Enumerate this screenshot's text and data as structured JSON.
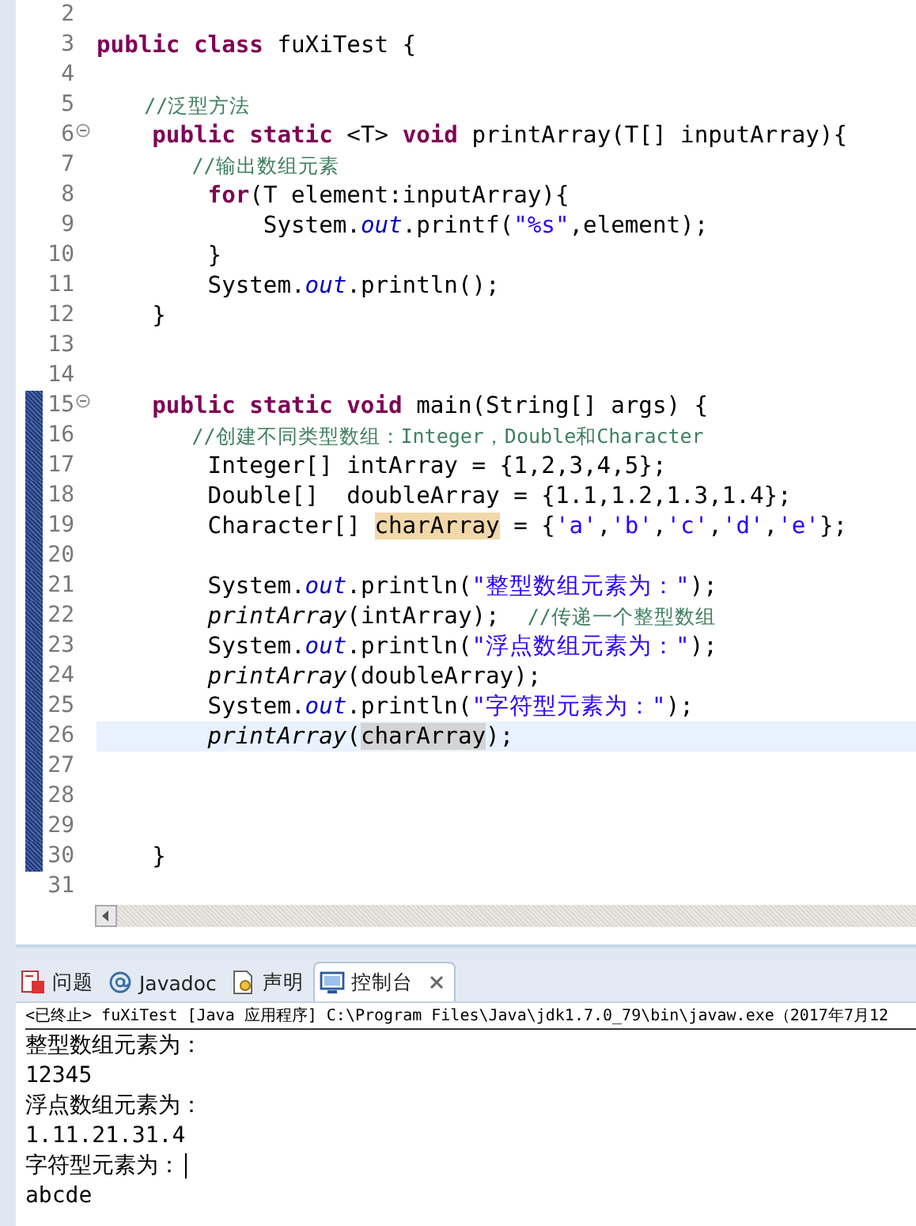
{
  "editor": {
    "lines": [
      {
        "number": "2",
        "changed": false,
        "fold": false,
        "current": false
      },
      {
        "number": "3",
        "changed": false,
        "fold": false,
        "current": false,
        "tokens": [
          {
            "t": "public class",
            "kind": "kw"
          },
          {
            "t": " fuXiTest {",
            "kind": "plain"
          }
        ]
      },
      {
        "number": "4",
        "changed": false,
        "fold": false,
        "current": false
      },
      {
        "number": "5",
        "changed": false,
        "fold": false,
        "current": false,
        "tokens": [
          {
            "t": "    //泛型方法",
            "kind": "comment"
          }
        ]
      },
      {
        "number": "6",
        "changed": false,
        "fold": true,
        "current": false,
        "tokens": [
          {
            "t": "    public static",
            "kind": "kw"
          },
          {
            "t": " <T> ",
            "kind": "plain"
          },
          {
            "t": "void",
            "kind": "kw"
          },
          {
            "t": " printArray(T[] inputArray){",
            "kind": "plain"
          }
        ]
      },
      {
        "number": "7",
        "changed": false,
        "fold": false,
        "current": false,
        "tokens": [
          {
            "t": "        //输出数组元素",
            "kind": "comment"
          }
        ]
      },
      {
        "number": "8",
        "changed": false,
        "fold": false,
        "current": false,
        "tokens": [
          {
            "t": "        for",
            "kind": "kw"
          },
          {
            "t": "(T element:inputArray){",
            "kind": "plain"
          }
        ]
      },
      {
        "number": "9",
        "changed": false,
        "fold": false,
        "current": false,
        "tokens": [
          {
            "t": "            System.",
            "kind": "plain"
          },
          {
            "t": "out",
            "kind": "field"
          },
          {
            "t": ".printf(",
            "kind": "plain"
          },
          {
            "t": "\"%s\"",
            "kind": "string"
          },
          {
            "t": ",element);",
            "kind": "plain"
          }
        ]
      },
      {
        "number": "10",
        "changed": false,
        "fold": false,
        "current": false,
        "tokens": [
          {
            "t": "        }",
            "kind": "plain"
          }
        ]
      },
      {
        "number": "11",
        "changed": false,
        "fold": false,
        "current": false,
        "tokens": [
          {
            "t": "        System.",
            "kind": "plain"
          },
          {
            "t": "out",
            "kind": "field"
          },
          {
            "t": ".println();",
            "kind": "plain"
          }
        ]
      },
      {
        "number": "12",
        "changed": false,
        "fold": false,
        "current": false,
        "tokens": [
          {
            "t": "    }",
            "kind": "plain"
          }
        ]
      },
      {
        "number": "13",
        "changed": false,
        "fold": false,
        "current": false
      },
      {
        "number": "14",
        "changed": false,
        "fold": false,
        "current": false
      },
      {
        "number": "15",
        "changed": true,
        "fold": true,
        "current": false,
        "tokens": [
          {
            "t": "    public static void",
            "kind": "kw"
          },
          {
            "t": " main(String[] args) {",
            "kind": "plain"
          }
        ]
      },
      {
        "number": "16",
        "changed": true,
        "fold": false,
        "current": false,
        "tokens": [
          {
            "t": "        //创建不同类型数组：Integer，Double和Character",
            "kind": "comment"
          }
        ]
      },
      {
        "number": "17",
        "changed": true,
        "fold": false,
        "current": false,
        "tokens": [
          {
            "t": "        Integer[] intArray = {1,2,3,4,5};",
            "kind": "plain"
          }
        ]
      },
      {
        "number": "18",
        "changed": true,
        "fold": false,
        "current": false,
        "tokens": [
          {
            "t": "        Double[]  doubleArray = {1.1,1.2,1.3,1.4};",
            "kind": "plain"
          }
        ]
      },
      {
        "number": "19",
        "changed": true,
        "fold": false,
        "current": false,
        "tokens": [
          {
            "t": "        Character[] ",
            "kind": "plain"
          },
          {
            "t": "charArray",
            "kind": "occurrence"
          },
          {
            "t": " = {",
            "kind": "plain"
          },
          {
            "t": "'a'",
            "kind": "string"
          },
          {
            "t": ",",
            "kind": "plain"
          },
          {
            "t": "'b'",
            "kind": "string"
          },
          {
            "t": ",",
            "kind": "plain"
          },
          {
            "t": "'c'",
            "kind": "string"
          },
          {
            "t": ",",
            "kind": "plain"
          },
          {
            "t": "'d'",
            "kind": "string"
          },
          {
            "t": ",",
            "kind": "plain"
          },
          {
            "t": "'e'",
            "kind": "string"
          },
          {
            "t": "};",
            "kind": "plain"
          }
        ]
      },
      {
        "number": "20",
        "changed": true,
        "fold": false,
        "current": false
      },
      {
        "number": "21",
        "changed": true,
        "fold": false,
        "current": false,
        "tokens": [
          {
            "t": "        System.",
            "kind": "plain"
          },
          {
            "t": "out",
            "kind": "field"
          },
          {
            "t": ".println(",
            "kind": "plain"
          },
          {
            "t": "\"整型数组元素为：\"",
            "kind": "string"
          },
          {
            "t": ");",
            "kind": "plain"
          }
        ]
      },
      {
        "number": "22",
        "changed": true,
        "fold": false,
        "current": false,
        "tokens": [
          {
            "t": "        printArray",
            "kind": "method"
          },
          {
            "t": "(intArray);  ",
            "kind": "plain"
          },
          {
            "t": "//传递一个整型数组",
            "kind": "comment"
          }
        ]
      },
      {
        "number": "23",
        "changed": true,
        "fold": false,
        "current": false,
        "tokens": [
          {
            "t": "        System.",
            "kind": "plain"
          },
          {
            "t": "out",
            "kind": "field"
          },
          {
            "t": ".println(",
            "kind": "plain"
          },
          {
            "t": "\"浮点数组元素为：\"",
            "kind": "string"
          },
          {
            "t": ");",
            "kind": "plain"
          }
        ]
      },
      {
        "number": "24",
        "changed": true,
        "fold": false,
        "current": false,
        "tokens": [
          {
            "t": "        printArray",
            "kind": "method"
          },
          {
            "t": "(doubleArray);",
            "kind": "plain"
          }
        ]
      },
      {
        "number": "25",
        "changed": true,
        "fold": false,
        "current": false,
        "tokens": [
          {
            "t": "        System.",
            "kind": "plain"
          },
          {
            "t": "out",
            "kind": "field"
          },
          {
            "t": ".println(",
            "kind": "plain"
          },
          {
            "t": "\"字符型元素为：\"",
            "kind": "string"
          },
          {
            "t": ");",
            "kind": "plain"
          }
        ]
      },
      {
        "number": "26",
        "changed": true,
        "fold": false,
        "current": true,
        "tokens": [
          {
            "t": "        printArray",
            "kind": "method"
          },
          {
            "t": "(",
            "kind": "plain"
          },
          {
            "t": "charArray",
            "kind": "selection"
          },
          {
            "t": ");",
            "kind": "plain"
          }
        ]
      },
      {
        "number": "27",
        "changed": true,
        "fold": false,
        "current": false
      },
      {
        "number": "28",
        "changed": true,
        "fold": false,
        "current": false
      },
      {
        "number": "29",
        "changed": true,
        "fold": false,
        "current": false
      },
      {
        "number": "30",
        "changed": true,
        "fold": false,
        "current": false,
        "tokens": [
          {
            "t": "    }",
            "kind": "plain"
          }
        ]
      },
      {
        "number": "31",
        "changed": false,
        "fold": false,
        "current": false
      }
    ]
  },
  "bottom_panel": {
    "tabs": [
      {
        "label": "问题",
        "selected": false
      },
      {
        "label": "Javadoc",
        "selected": false
      },
      {
        "label": "声明",
        "selected": false
      },
      {
        "label": "控制台",
        "selected": true
      }
    ],
    "console": {
      "header": "<已终止> fuXiTest [Java 应用程序] C:\\Program Files\\Java\\jdk1.7.0_79\\bin\\javaw.exe（2017年7月12",
      "output": [
        {
          "text": "整型数组元素为：",
          "cursor": false
        },
        {
          "text": "12345",
          "cursor": false
        },
        {
          "text": "浮点数组元素为：",
          "cursor": false
        },
        {
          "text": "1.11.21.31.4",
          "cursor": false
        },
        {
          "text": "字符型元素为：",
          "cursor": true
        },
        {
          "text": "abcde",
          "cursor": false
        }
      ]
    }
  }
}
